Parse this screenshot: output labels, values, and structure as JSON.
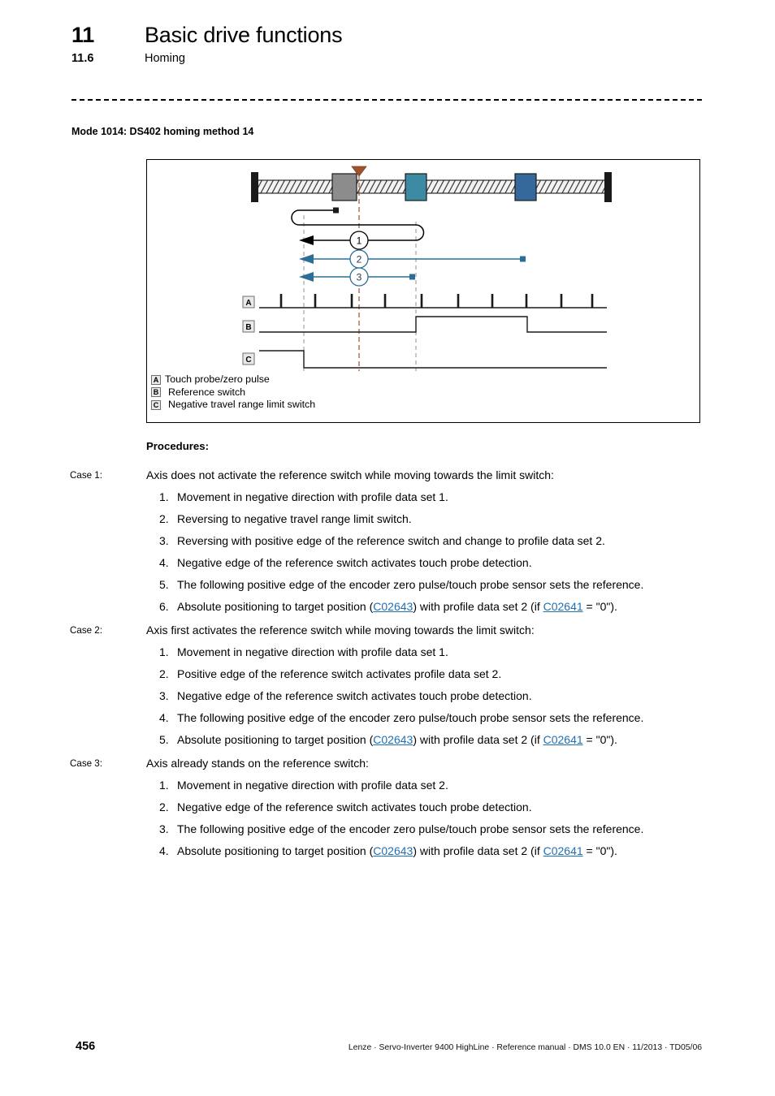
{
  "header": {
    "chapter_number": "11",
    "chapter_title": "Basic drive functions",
    "section_number": "11.6",
    "section_title": "Homing"
  },
  "mode_heading": "Mode 1014: DS402 homing method 14",
  "figure": {
    "legend": [
      {
        "key": "A",
        "text": "Touch probe/zero pulse"
      },
      {
        "key": "B",
        "text": "Reference switch"
      },
      {
        "key": "C",
        "text": "Negative travel range limit switch"
      }
    ],
    "motion_paths": [
      {
        "number": "1",
        "color": "#000000",
        "direction": "negative"
      },
      {
        "number": "2",
        "color": "#2d6e96",
        "direction": "negative"
      },
      {
        "number": "3",
        "color": "#2d6e96",
        "direction": "negative"
      }
    ],
    "blocks": [
      {
        "name": "carriage",
        "color": "#8c8c8c"
      },
      {
        "name": "reference-switch",
        "color": "#3d8ba3"
      },
      {
        "name": "travel-limit",
        "color": "#35699b"
      }
    ],
    "marker_color": "#a0522d",
    "signals": [
      "A",
      "B",
      "C"
    ]
  },
  "procedures": {
    "title": "Procedures:",
    "cases": [
      {
        "label": "Case 1:",
        "heading": "Axis does not activate the reference switch while moving towards the limit switch:",
        "steps": [
          {
            "n": "1.",
            "html": "Movement in negative direction with profile data set 1."
          },
          {
            "n": "2.",
            "html": "Reversing to negative travel range limit switch."
          },
          {
            "n": "3.",
            "html": "Reversing with positive edge of the reference switch and change to profile data set 2."
          },
          {
            "n": "4.",
            "html": "Negative edge of the reference switch activates touch probe detection."
          },
          {
            "n": "5.",
            "html": "The following positive edge of the encoder zero pulse/touch probe sensor sets the reference."
          },
          {
            "n": "6.",
            "html": "Absolute positioning to target position (<a class=\"link\" data-name=\"link-c02643\" data-interactable=\"true\">C02643</a>) with profile data set 2 (if <a class=\"link\" data-name=\"link-c02641\" data-interactable=\"true\">C02641</a> = \"0\")."
          }
        ]
      },
      {
        "label": "Case 2:",
        "heading": "Axis first activates the reference switch while moving towards the limit switch:",
        "steps": [
          {
            "n": "1.",
            "html": "Movement in negative direction with profile data set 1."
          },
          {
            "n": "2.",
            "html": "Positive edge of the reference switch activates profile data set 2."
          },
          {
            "n": "3.",
            "html": "Negative edge of the reference switch activates touch probe detection."
          },
          {
            "n": "4.",
            "html": "The following positive edge of the encoder zero pulse/touch probe sensor sets the reference."
          },
          {
            "n": "5.",
            "html": "Absolute positioning to target position (<a class=\"link\" data-name=\"link-c02643\" data-interactable=\"true\">C02643</a>) with profile data set 2 (if <a class=\"link\" data-name=\"link-c02641\" data-interactable=\"true\">C02641</a> = \"0\")."
          }
        ]
      },
      {
        "label": "Case 3:",
        "heading": "Axis already stands on the reference switch:",
        "steps": [
          {
            "n": "1.",
            "html": "Movement in negative direction with profile data set 2."
          },
          {
            "n": "2.",
            "html": "Negative edge of the reference switch activates touch probe detection."
          },
          {
            "n": "3.",
            "html": "The following positive edge of the encoder zero pulse/touch probe sensor sets the reference."
          },
          {
            "n": "4.",
            "html": "Absolute positioning to target position (<a class=\"link\" data-name=\"link-c02643\" data-interactable=\"true\">C02643</a>) with profile data set 2 (if <a class=\"link\" data-name=\"link-c02641\" data-interactable=\"true\">C02641</a> = \"0\")."
          }
        ]
      }
    ]
  },
  "footer": {
    "page_number": "456",
    "text": "Lenze · Servo-Inverter 9400 HighLine · Reference manual · DMS 10.0 EN · 11/2013 · TD05/06"
  }
}
